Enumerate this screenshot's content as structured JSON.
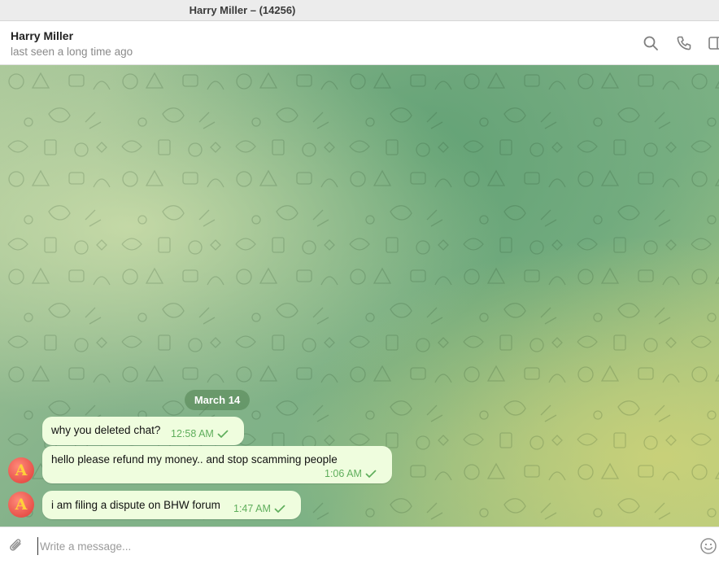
{
  "window": {
    "title": "Harry Miller – (14256)"
  },
  "header": {
    "name": "Harry Miller",
    "status": "last seen a long time ago",
    "icons": [
      "search-icon",
      "phone-icon",
      "sidebar-toggle-icon"
    ]
  },
  "chat": {
    "date_label": "March 14",
    "messages": [
      {
        "text": "why you deleted chat?",
        "time": "12:58 AM",
        "status": "read"
      },
      {
        "text": "hello please refund my money.. and stop scamming people",
        "time": "1:06 AM",
        "status": "read"
      },
      {
        "text": "i am filing a dispute on BHW forum",
        "time": "1:47 AM",
        "status": "read"
      }
    ],
    "avatar_letter": "A"
  },
  "composer": {
    "placeholder": "Write a message...",
    "value": ""
  },
  "colors": {
    "bubble": "#effdde",
    "time_text": "#5fae5c",
    "avatar": "#e8524a",
    "date_pill": "#6b9b6a"
  }
}
